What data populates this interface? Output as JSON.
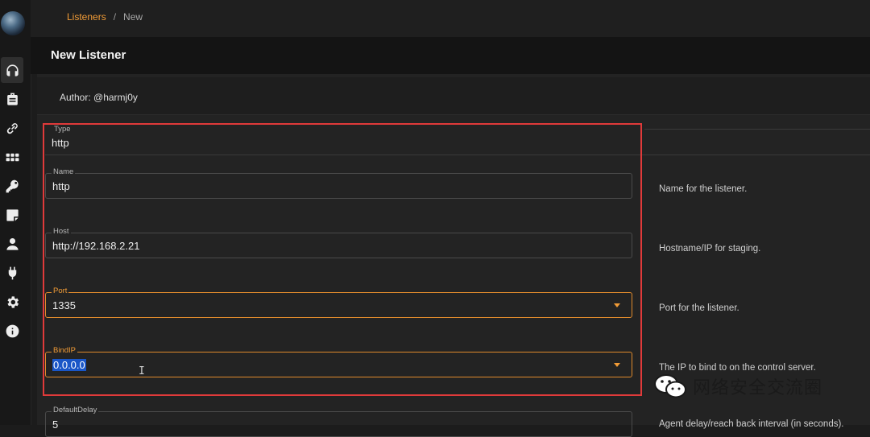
{
  "breadcrumb": {
    "parent": "Listeners",
    "separator": "/",
    "current": "New"
  },
  "page_title": "New Listener",
  "author": "Author: @harmj0y",
  "sidebar": {
    "items": [
      {
        "icon": "headset-icon",
        "active": true
      },
      {
        "icon": "briefcase-icon",
        "active": false
      },
      {
        "icon": "link-icon",
        "active": false
      },
      {
        "icon": "grid-icon",
        "active": false
      },
      {
        "icon": "key-icon",
        "active": false
      },
      {
        "icon": "note-icon",
        "active": false
      },
      {
        "icon": "user-icon",
        "active": false
      },
      {
        "icon": "plug-icon",
        "active": false
      },
      {
        "icon": "gear-icon",
        "active": false
      },
      {
        "icon": "info-icon",
        "active": false
      }
    ]
  },
  "form": {
    "type": {
      "label": "Type",
      "value": "http"
    },
    "name": {
      "label": "Name",
      "value": "http",
      "hint": "Name for the listener."
    },
    "host": {
      "label": "Host",
      "value": "http://192.168.2.21",
      "hint": "Hostname/IP for staging."
    },
    "port": {
      "label": "Port",
      "value": "1335",
      "hint": "Port for the listener."
    },
    "bindip": {
      "label": "BindIP",
      "value": "0.0.0.0",
      "hint": "The IP to bind to on the control server."
    },
    "defaultdelay": {
      "label": "DefaultDelay",
      "value": "5",
      "hint": "Agent delay/reach back interval (in seconds)."
    }
  },
  "watermark": {
    "text": "网络安全交流圈"
  },
  "colors": {
    "accent": "#f29c37",
    "highlight": "#e03a3a",
    "selection": "#1a56c7"
  }
}
